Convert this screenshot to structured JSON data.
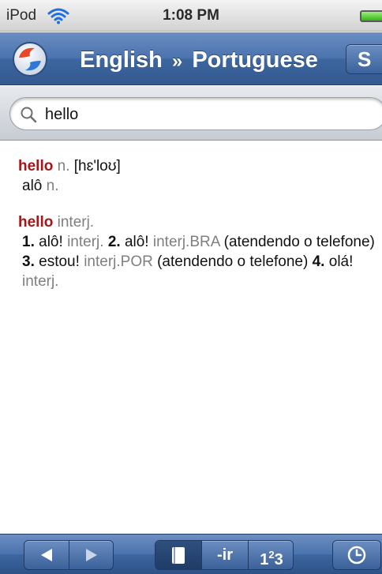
{
  "status_bar": {
    "carrier": "iPod",
    "time": "1:08 PM",
    "wifi_icon": "wifi-icon",
    "battery_icon": "battery-full-icon"
  },
  "nav_bar": {
    "logo_icon": "app-logo-icon",
    "source_language": "English",
    "separator": "»",
    "target_language": "Portuguese",
    "swap_label": "S"
  },
  "search": {
    "value": "hello",
    "icon": "search-icon"
  },
  "entries": [
    {
      "headword": "hello",
      "pos": "n.",
      "pronunciation": "[hɛ'loʊ]",
      "translation": "alô",
      "translation_pos": "n."
    },
    {
      "headword": "hello",
      "pos": "interj.",
      "senses": [
        {
          "num": "1.",
          "word": "alô!",
          "label": "interj.",
          "note": ""
        },
        {
          "num": "2.",
          "word": "alô!",
          "label": "interj.BRA",
          "note": "(atendendo o telefone)"
        },
        {
          "num": "3.",
          "word": "estou!",
          "label": "interj.POR",
          "note": "(atendendo o telefone)"
        },
        {
          "num": "4.",
          "word": "olá!",
          "label": "interj.",
          "note": ""
        }
      ]
    }
  ],
  "toolbar": {
    "back_icon": "back-arrow-icon",
    "forward_icon": "forward-arrow-icon",
    "dictionary_icon": "book-icon",
    "conjugation_label": "-ir",
    "numbers_label_base_1": "1",
    "numbers_label_sup": "2",
    "numbers_label_base_2": "3",
    "history_icon": "clock-icon"
  },
  "colors": {
    "nav_blue": "#4a72ad",
    "headword_red": "#a3161a",
    "label_gray": "#7f7f7f"
  }
}
